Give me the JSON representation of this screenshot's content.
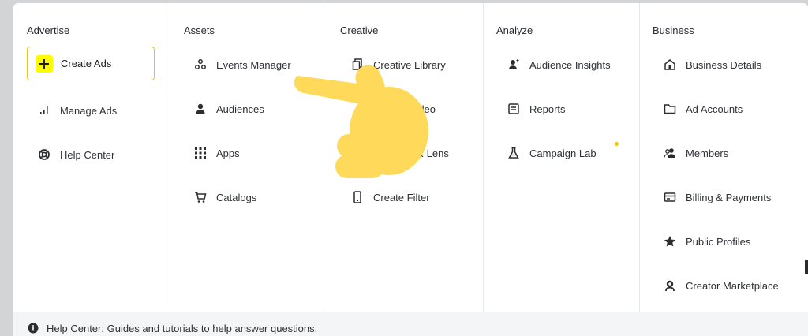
{
  "columns": {
    "advertise": {
      "header": "Advertise",
      "create_ads": "Create Ads",
      "manage_ads": "Manage Ads",
      "help_center": "Help Center"
    },
    "assets": {
      "header": "Assets",
      "items": [
        "Events Manager",
        "Audiences",
        "Apps",
        "Catalogs"
      ]
    },
    "creative": {
      "header": "Creative",
      "items": [
        "Creative Library",
        "Video",
        "AR Lens",
        "Create Filter"
      ]
    },
    "analyze": {
      "header": "Analyze",
      "items": [
        "Audience Insights",
        "Reports",
        "Campaign Lab"
      ]
    },
    "business": {
      "header": "Business",
      "items": [
        "Business Details",
        "Ad Accounts",
        "Members",
        "Billing & Payments",
        "Public Profiles",
        "Creator Marketplace"
      ]
    }
  },
  "footer": {
    "text": "Help Center: Guides and tutorials to help answer questions."
  },
  "colors": {
    "accent_yellow": "#fffc00",
    "border_yellow": "#f0c400",
    "new_dot": "#f7c600",
    "pointing_hand": "#ffd95a"
  },
  "icons": {
    "create_ads": "plus-icon",
    "manage_ads": "bar-chart-icon",
    "help_center": "lifebuoy-icon",
    "events_manager": "nodes-icon",
    "audiences": "person-icon",
    "apps": "grid-icon",
    "catalogs": "cart-icon",
    "creative_library": "stack-icon",
    "create_filter": "phone-icon",
    "audience_insights": "person-sparkle-icon",
    "reports": "document-icon",
    "campaign_lab": "flask-icon",
    "business_details": "home-icon",
    "ad_accounts": "folder-icon",
    "members": "people-icon",
    "billing": "card-icon",
    "public_profiles": "star-icon",
    "creator_marketplace": "creator-icon",
    "footer_info": "info-icon",
    "overlay": "pointing-hand-emoji"
  }
}
